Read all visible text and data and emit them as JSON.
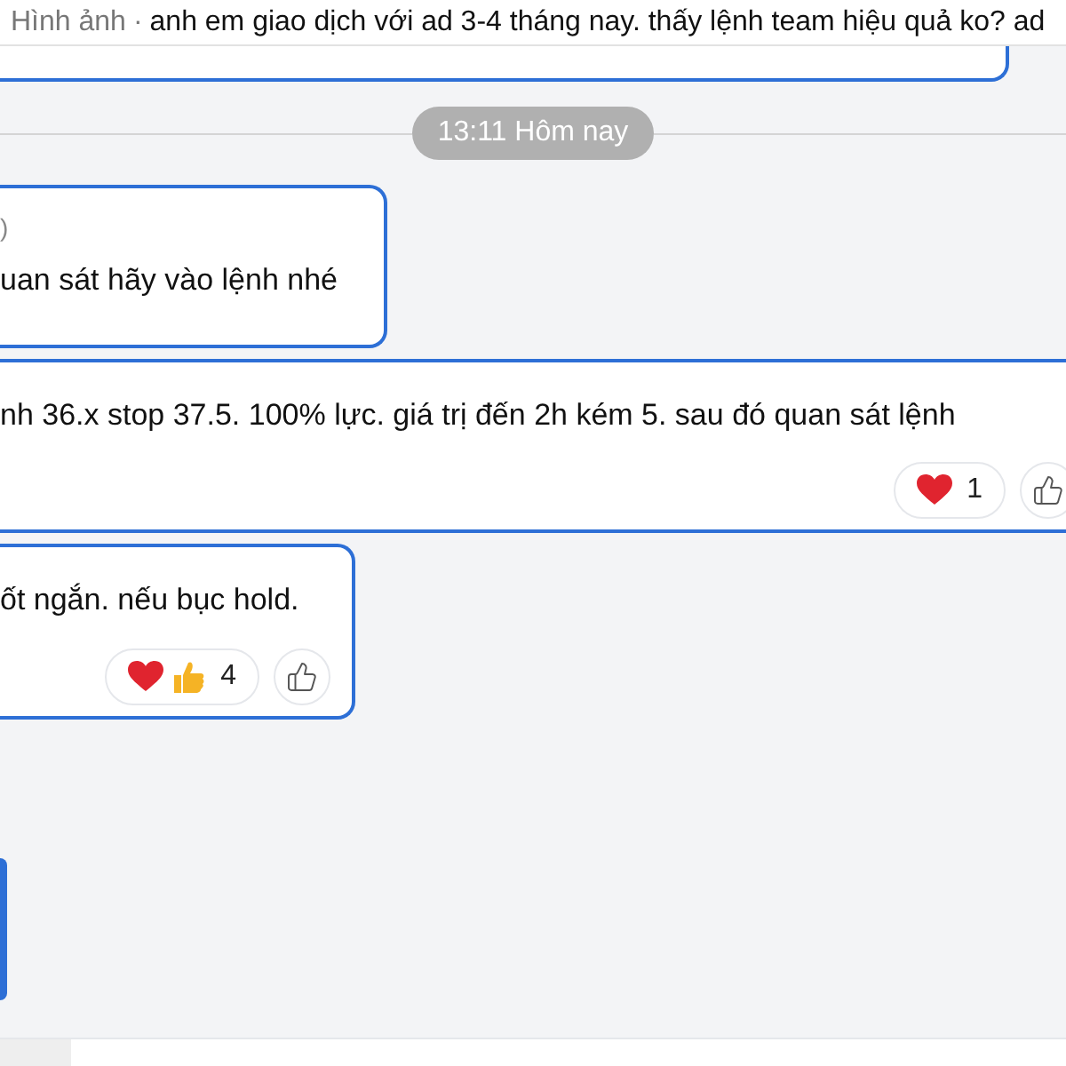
{
  "quoted_message": {
    "label": "Hình ảnh",
    "separator": "·",
    "text": "anh em giao dịch với ad 3-4 tháng nay. thấy lệnh team hiệu quả ko? ad"
  },
  "time_divider": "13:11 Hôm nay",
  "messages": [
    {
      "quote": ")",
      "text": "uan sát hãy vào lệnh nhé"
    },
    {
      "text": "nh 36.x stop 37.5. 100% lực. giá trị đến 2h kém 5. sau đó quan sát lệnh",
      "reactions": [
        {
          "emojis": [
            {
              "kind": "heart"
            }
          ],
          "count": "1"
        }
      ]
    },
    {
      "text": "ốt ngắn. nếu bục hold.",
      "reactions": [
        {
          "emojis": [
            {
              "kind": "heart"
            },
            {
              "kind": "thumbs-up"
            }
          ],
          "count": "4"
        }
      ]
    }
  ]
}
